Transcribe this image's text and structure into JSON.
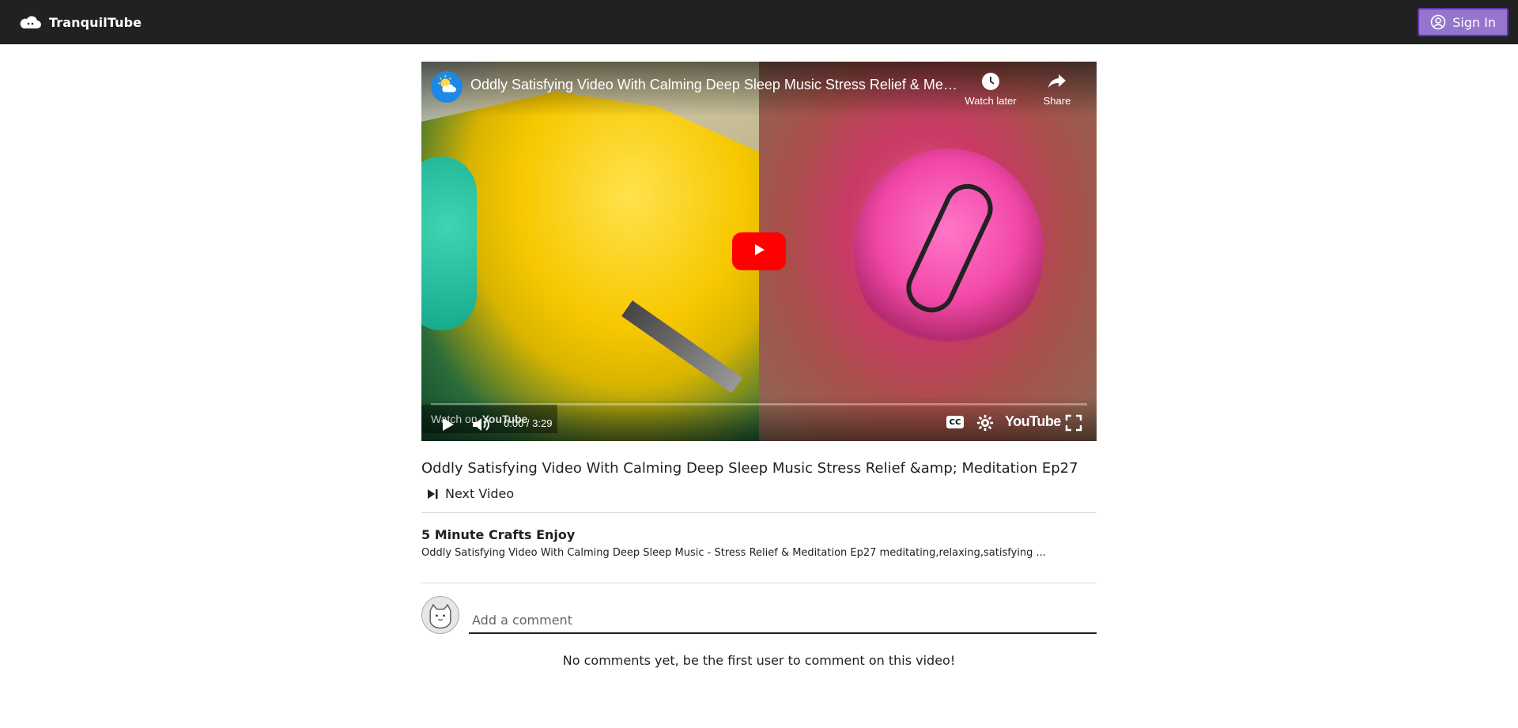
{
  "app": {
    "name": "TranquilTube"
  },
  "header": {
    "signin_label": "Sign In"
  },
  "player": {
    "title": "Oddly Satisfying Video With Calming Deep Sleep Music Stress Relief & Medit…",
    "watch_later_label": "Watch later",
    "share_label": "Share",
    "watch_on_label": "Watch on",
    "youtube_mini_label": "YouTube",
    "time": "0:00 / 3:29",
    "cc_label": "CC",
    "youtube_logo_label": "YouTube",
    "progress": 0.0
  },
  "video": {
    "title": "Oddly Satisfying Video With Calming Deep Sleep Music Stress Relief &amp; Meditation Ep27",
    "next_label": "Next Video",
    "channel": "5 Minute Crafts Enjoy",
    "description": "Oddly Satisfying Video With Calming Deep Sleep Music - Stress Relief & Meditation Ep27 meditating,relaxing,satisfying ..."
  },
  "comments": {
    "placeholder": "Add a comment",
    "empty_text": "No comments yet, be the first user to comment on this video!"
  },
  "colors": {
    "topbar": "#212121",
    "signin_bg": "#9575cd",
    "signin_border": "#5e35b1",
    "youtube_red": "#ff0000"
  },
  "icons": {
    "brand": "cloud-icon",
    "signin": "user-circle-icon",
    "channel": "sun-cloud-icon",
    "watch_later": "clock-icon",
    "share": "share-arrow-icon",
    "play_big": "play-icon",
    "volume": "volume-icon",
    "settings": "gear-icon",
    "fullscreen": "fullscreen-icon",
    "next": "skip-next-icon",
    "avatar": "cat-avatar-icon"
  }
}
